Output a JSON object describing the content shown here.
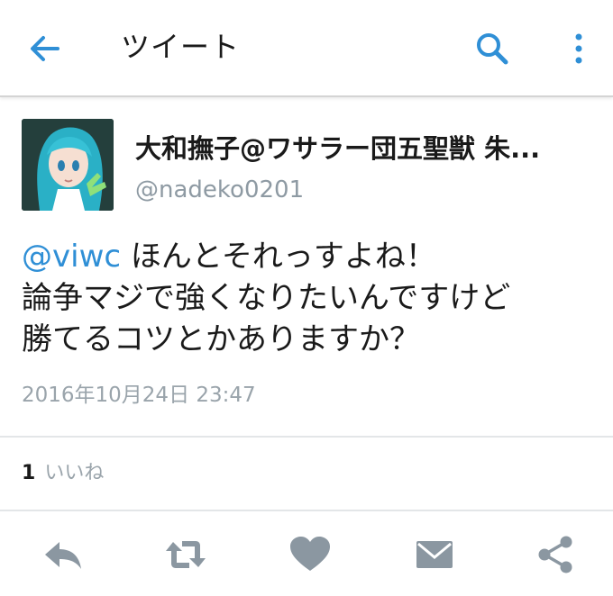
{
  "header": {
    "title": "ツイート",
    "back_icon": "arrow-left-icon",
    "search_icon": "search-icon",
    "more_icon": "more-vertical-icon",
    "accent_color": "#2f8fd6"
  },
  "author": {
    "display_name": "大和撫子@ワサラー団五聖獣 朱...",
    "handle": "@nadeko0201",
    "avatar_icon": "avatar-icon"
  },
  "tweet": {
    "mention": "@viwc",
    "line1_rest": " ほんとそれっすよね！",
    "line2": "論争マジで強くなりたいんですけど",
    "line3": "勝てるコツとかありますか？",
    "timestamp": "2016年10月24日 23:47"
  },
  "stats": {
    "like_count": "1",
    "like_label": "いいね"
  },
  "actions": {
    "icons": [
      "reply-icon",
      "retweet-icon",
      "heart-icon",
      "mail-icon",
      "share-icon"
    ],
    "icon_color": "#8b97a1"
  }
}
